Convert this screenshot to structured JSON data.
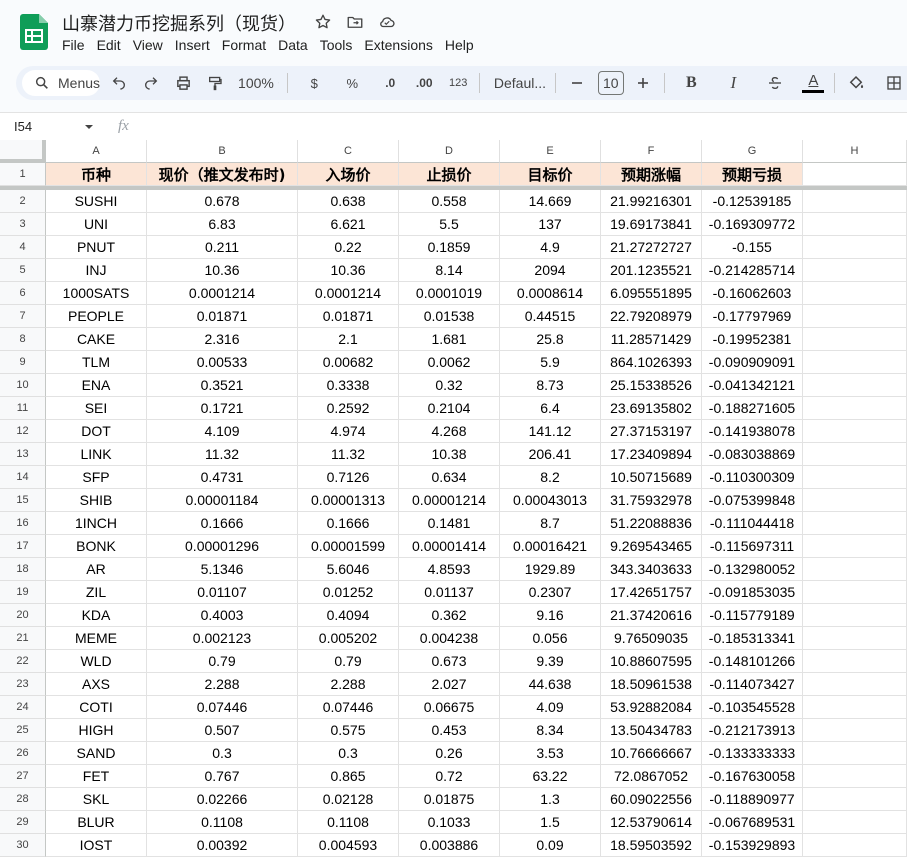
{
  "doc": {
    "title": "山寨潜力币挖掘系列（现货）",
    "menu": [
      "File",
      "Edit",
      "View",
      "Insert",
      "Format",
      "Data",
      "Tools",
      "Extensions",
      "Help"
    ]
  },
  "toolbar": {
    "search_label": "Menus",
    "zoom": "100%",
    "currency": "$",
    "percent": "%",
    "dec_decrease": ".0",
    "dec_increase": ".00",
    "number_format": "123",
    "font": "Defaul...",
    "font_size": "10",
    "bold": "B",
    "italic": "I",
    "text_color": "A"
  },
  "formula_bar": {
    "cell_ref": "I54",
    "fx": "fx"
  },
  "columns": [
    "A",
    "B",
    "C",
    "D",
    "E",
    "F",
    "G",
    "H"
  ],
  "headers": [
    "币种",
    "现价（推文发布时)",
    "入场价",
    "止损价",
    "目标价",
    "预期涨幅",
    "预期亏损"
  ],
  "rows": [
    [
      "SUSHI",
      "0.678",
      "0.638",
      "0.558",
      "14.669",
      "21.99216301",
      "-0.12539185"
    ],
    [
      "UNI",
      "6.83",
      "6.621",
      "5.5",
      "137",
      "19.69173841",
      "-0.169309772"
    ],
    [
      "PNUT",
      "0.211",
      "0.22",
      "0.1859",
      "4.9",
      "21.27272727",
      "-0.155"
    ],
    [
      "INJ",
      "10.36",
      "10.36",
      "8.14",
      "2094",
      "201.1235521",
      "-0.214285714"
    ],
    [
      "1000SATS",
      "0.0001214",
      "0.0001214",
      "0.0001019",
      "0.0008614",
      "6.095551895",
      "-0.16062603"
    ],
    [
      "PEOPLE",
      "0.01871",
      "0.01871",
      "0.01538",
      "0.44515",
      "22.79208979",
      "-0.17797969"
    ],
    [
      "CAKE",
      "2.316",
      "2.1",
      "1.681",
      "25.8",
      "11.28571429",
      "-0.19952381"
    ],
    [
      "TLM",
      "0.00533",
      "0.00682",
      "0.0062",
      "5.9",
      "864.1026393",
      "-0.090909091"
    ],
    [
      "ENA",
      "0.3521",
      "0.3338",
      "0.32",
      "8.73",
      "25.15338526",
      "-0.041342121"
    ],
    [
      "SEI",
      "0.1721",
      "0.2592",
      "0.2104",
      "6.4",
      "23.69135802",
      "-0.188271605"
    ],
    [
      "DOT",
      "4.109",
      "4.974",
      "4.268",
      "141.12",
      "27.37153197",
      "-0.141938078"
    ],
    [
      "LINK",
      "11.32",
      "11.32",
      "10.38",
      "206.41",
      "17.23409894",
      "-0.083038869"
    ],
    [
      "SFP",
      "0.4731",
      "0.7126",
      "0.634",
      "8.2",
      "10.50715689",
      "-0.110300309"
    ],
    [
      "SHIB",
      "0.00001184",
      "0.00001313",
      "0.00001214",
      "0.00043013",
      "31.75932978",
      "-0.075399848"
    ],
    [
      "1INCH",
      "0.1666",
      "0.1666",
      "0.1481",
      "8.7",
      "51.22088836",
      "-0.111044418"
    ],
    [
      "BONK",
      "0.00001296",
      "0.00001599",
      "0.00001414",
      "0.00016421",
      "9.269543465",
      "-0.115697311"
    ],
    [
      "AR",
      "5.1346",
      "5.6046",
      "4.8593",
      "1929.89",
      "343.3403633",
      "-0.132980052"
    ],
    [
      "ZIL",
      "0.01107",
      "0.01252",
      "0.01137",
      "0.2307",
      "17.42651757",
      "-0.091853035"
    ],
    [
      "KDA",
      "0.4003",
      "0.4094",
      "0.362",
      "9.16",
      "21.37420616",
      "-0.115779189"
    ],
    [
      "MEME",
      "0.002123",
      "0.005202",
      "0.004238",
      "0.056",
      "9.76509035",
      "-0.185313341"
    ],
    [
      "WLD",
      "0.79",
      "0.79",
      "0.673",
      "9.39",
      "10.88607595",
      "-0.148101266"
    ],
    [
      "AXS",
      "2.288",
      "2.288",
      "2.027",
      "44.638",
      "18.50961538",
      "-0.114073427"
    ],
    [
      "COTI",
      "0.07446",
      "0.07446",
      "0.06675",
      "4.09",
      "53.92882084",
      "-0.103545528"
    ],
    [
      "HIGH",
      "0.507",
      "0.575",
      "0.453",
      "8.34",
      "13.50434783",
      "-0.212173913"
    ],
    [
      "SAND",
      "0.3",
      "0.3",
      "0.26",
      "3.53",
      "10.76666667",
      "-0.133333333"
    ],
    [
      "FET",
      "0.767",
      "0.865",
      "0.72",
      "63.22",
      "72.0867052",
      "-0.167630058"
    ],
    [
      "SKL",
      "0.02266",
      "0.02128",
      "0.01875",
      "1.3",
      "60.09022556",
      "-0.118890977"
    ],
    [
      "BLUR",
      "0.1108",
      "0.1108",
      "0.1033",
      "1.5",
      "12.53790614",
      "-0.067689531"
    ],
    [
      "IOST",
      "0.00392",
      "0.004593",
      "0.003886",
      "0.09",
      "18.59503592",
      "-0.153929893"
    ]
  ],
  "colors": {
    "header_fill": "#fce5d6",
    "sheets_green": "#0f9d58"
  }
}
